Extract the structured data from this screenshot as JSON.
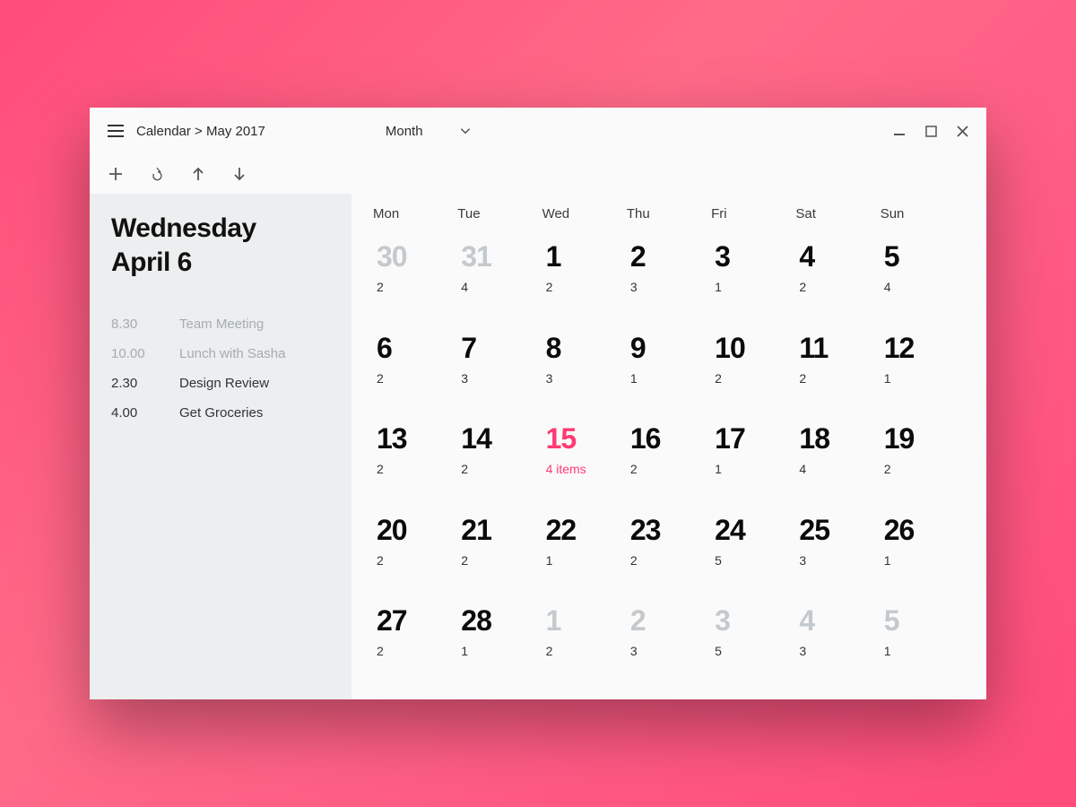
{
  "breadcrumb": {
    "app": "Calendar",
    "sep": ">",
    "loc": "May 2017"
  },
  "viewSelector": {
    "label": "Month"
  },
  "dow": [
    "Mon",
    "Tue",
    "Wed",
    "Thu",
    "Fri",
    "Sat",
    "Sun"
  ],
  "selected": {
    "line1": "Wednesday",
    "line2": "April 6"
  },
  "agenda": [
    {
      "time": "8.30",
      "title": "Team Meeting",
      "muted": true
    },
    {
      "time": "10.00",
      "title": "Lunch with Sasha",
      "muted": true
    },
    {
      "time": "2.30",
      "title": "Design Review",
      "muted": false
    },
    {
      "time": "4.00",
      "title": "Get Groceries",
      "muted": false
    }
  ],
  "cells": [
    {
      "n": "30",
      "c": "2",
      "out": true
    },
    {
      "n": "31",
      "c": "4",
      "out": true
    },
    {
      "n": "1",
      "c": "2"
    },
    {
      "n": "2",
      "c": "3"
    },
    {
      "n": "3",
      "c": "1"
    },
    {
      "n": "4",
      "c": "2"
    },
    {
      "n": "5",
      "c": "4"
    },
    {
      "n": "6",
      "c": "2"
    },
    {
      "n": "7",
      "c": "3"
    },
    {
      "n": "8",
      "c": "3"
    },
    {
      "n": "9",
      "c": "1"
    },
    {
      "n": "10",
      "c": "2"
    },
    {
      "n": "11",
      "c": "2"
    },
    {
      "n": "12",
      "c": "1"
    },
    {
      "n": "13",
      "c": "2"
    },
    {
      "n": "14",
      "c": "2"
    },
    {
      "n": "15",
      "c": "4 items",
      "today": true
    },
    {
      "n": "16",
      "c": "2"
    },
    {
      "n": "17",
      "c": "1"
    },
    {
      "n": "18",
      "c": "4"
    },
    {
      "n": "19",
      "c": "2"
    },
    {
      "n": "20",
      "c": "2"
    },
    {
      "n": "21",
      "c": "2"
    },
    {
      "n": "22",
      "c": "1"
    },
    {
      "n": "23",
      "c": "2"
    },
    {
      "n": "24",
      "c": "5"
    },
    {
      "n": "25",
      "c": "3"
    },
    {
      "n": "26",
      "c": "1"
    },
    {
      "n": "27",
      "c": "2"
    },
    {
      "n": "28",
      "c": "1"
    },
    {
      "n": "1",
      "c": "2",
      "out": true
    },
    {
      "n": "2",
      "c": "3",
      "out": true
    },
    {
      "n": "3",
      "c": "5",
      "out": true
    },
    {
      "n": "4",
      "c": "3",
      "out": true
    },
    {
      "n": "5",
      "c": "1",
      "out": true
    }
  ]
}
